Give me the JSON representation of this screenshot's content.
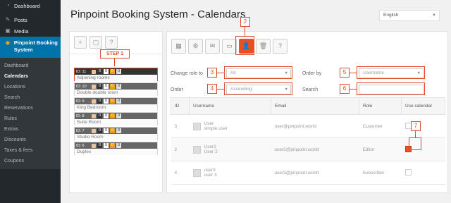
{
  "sidebar": {
    "top_items": [
      {
        "icon": "dashboard-icon",
        "glyph": "◔",
        "label": "Dashboard"
      },
      {
        "icon": "pin-icon",
        "glyph": "✎",
        "label": "Posts"
      },
      {
        "icon": "media-icon",
        "glyph": "▣",
        "label": "Media"
      }
    ],
    "plugin_label": "Pinpoint Booking System",
    "sub_items": [
      "Dashboard",
      "Calendars",
      "Locations",
      "Search",
      "Reservations",
      "Rules",
      "Extras",
      "Discounts",
      "Taxes & fees",
      "Coupons"
    ],
    "current_sub": "Calendars"
  },
  "header": {
    "title": "Pinpoint Booking System - Calendars",
    "language": "English"
  },
  "left_toolbar": [
    "+",
    "▢",
    "?"
  ],
  "step_label": "STEP 1",
  "calendars": [
    {
      "id": "ID: 11",
      "nums": [
        "0",
        "0",
        "0",
        "0"
      ],
      "name": "Adjoining rooms"
    },
    {
      "id": "ID: 10",
      "nums": [
        "0",
        "0",
        "0",
        "0"
      ],
      "name": "Double double room"
    },
    {
      "id": "ID: 9",
      "nums": [
        "0",
        "0",
        "0",
        "0"
      ],
      "name": "King Bedroom"
    },
    {
      "id": "ID: 8",
      "nums": [
        "0",
        "0",
        "0",
        "0"
      ],
      "name": "Suite Room"
    },
    {
      "id": "ID: 7",
      "nums": [
        "0",
        "0",
        "0",
        "0"
      ],
      "name": "Studio Room"
    },
    {
      "id": "ID: 6",
      "nums": [
        "0",
        "0",
        "0",
        "0"
      ],
      "name": "Duplex"
    }
  ],
  "right_toolbar": [
    "▦",
    "⚙",
    "✉",
    "▭",
    "👤",
    "🗑",
    "?"
  ],
  "filters": {
    "change_role_label": "Change role to",
    "change_role_value": "All",
    "order_label": "Order",
    "order_value": "Ascending",
    "order_by_label": "Order by",
    "order_by_value": "Username",
    "search_label": "Search"
  },
  "callouts": [
    "2",
    "3",
    "4",
    "5",
    "6",
    "7"
  ],
  "table": {
    "headers": [
      "ID",
      "Username",
      "Email",
      "Role",
      "Use calendar"
    ],
    "rows": [
      {
        "id": "3",
        "user": "User",
        "name": "simple user",
        "email": "user@pinpoint.world",
        "role": "Customer",
        "checked": false
      },
      {
        "id": "2",
        "user": "User2",
        "name": "User 2",
        "email": "user2@pinpoint.world",
        "role": "Editor",
        "checked": true
      },
      {
        "id": "4",
        "user": "user3",
        "name": "user 3",
        "email": "user3@pinpoint.world",
        "role": "Subscriber",
        "checked": false
      }
    ]
  },
  "colors": {
    "accent": "#e8501f",
    "sidebar": "#23282d",
    "active": "#0073aa"
  }
}
